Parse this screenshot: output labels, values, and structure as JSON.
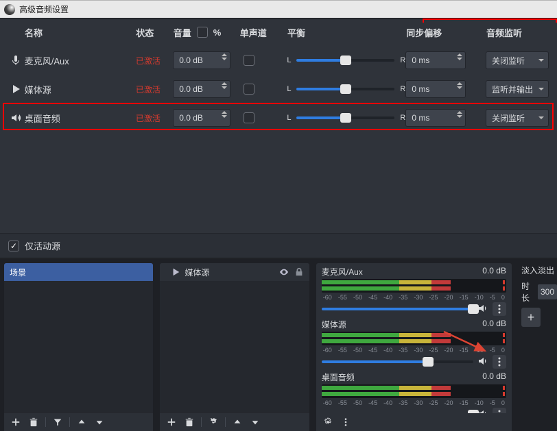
{
  "window": {
    "title": "高级音频设置"
  },
  "headers": {
    "name": "名称",
    "state": "状态",
    "volume": "音量",
    "percent": "%",
    "mono": "单声道",
    "balance": "平衡",
    "sync": "同步偏移",
    "monitor": "音频监听"
  },
  "balance_labels": {
    "left": "L",
    "right": "R"
  },
  "rows": [
    {
      "name": "麦克风/Aux",
      "state": "已激活",
      "volume": "0.0 dB",
      "balance": 50,
      "sync": "0 ms",
      "monitor": "关闭监听",
      "icon": "mic"
    },
    {
      "name": "媒体源",
      "state": "已激活",
      "volume": "0.0 dB",
      "balance": 50,
      "sync": "0 ms",
      "monitor": "监听并输出",
      "icon": "play"
    },
    {
      "name": "桌面音频",
      "state": "已激活",
      "volume": "0.0 dB",
      "balance": 50,
      "sync": "0 ms",
      "monitor": "关闭监听",
      "icon": "speaker"
    }
  ],
  "footer": {
    "active_only": "仅活动源"
  },
  "scenes": {
    "title": "场景"
  },
  "sources": {
    "title": "媒体源"
  },
  "mixer": {
    "ticks": [
      "-60",
      "-55",
      "-50",
      "-45",
      "-40",
      "-35",
      "-30",
      "-25",
      "-20",
      "-15",
      "-10",
      "-5",
      "0"
    ],
    "channels": [
      {
        "name": "麦克风/Aux",
        "level": "0.0 dB",
        "fill_pct": 70,
        "peak_pct": 98,
        "slider_pct": 100
      },
      {
        "name": "媒体源",
        "level": "0.0 dB",
        "fill_pct": 70,
        "peak_pct": 98,
        "slider_pct": 70
      },
      {
        "name": "桌面音频",
        "level": "0.0 dB",
        "fill_pct": 70,
        "peak_pct": 98,
        "slider_pct": 100
      }
    ]
  },
  "transition": {
    "label": "淡入淡出",
    "duration_label": "时长",
    "duration_value": "300"
  }
}
